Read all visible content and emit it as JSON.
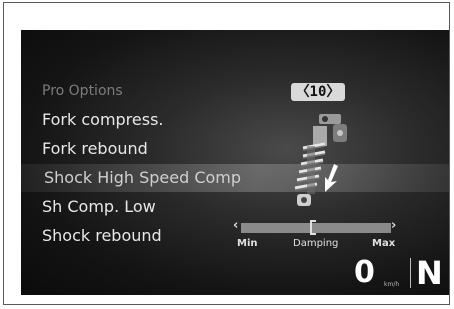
{
  "menu": {
    "header": "Pro Options",
    "items": [
      {
        "label": "Fork compress."
      },
      {
        "label": "Fork rebound"
      },
      {
        "label": "Shock High Speed Comp",
        "selected": true
      },
      {
        "label": "Sh Comp. Low"
      },
      {
        "label": "Shock rebound"
      }
    ]
  },
  "setting": {
    "value_display": "〈10〉"
  },
  "damping_slider": {
    "left_chevron": "‹",
    "right_chevron": "›",
    "min_label": "Min",
    "center_label": "Damping",
    "max_label": "Max",
    "level_fraction": 0.47
  },
  "status": {
    "speed": "0",
    "speed_unit": "km/h",
    "gear": "N"
  },
  "icons": {
    "shock_absorber": "shock-absorber-icon",
    "arrow": "down-arrow-icon"
  }
}
